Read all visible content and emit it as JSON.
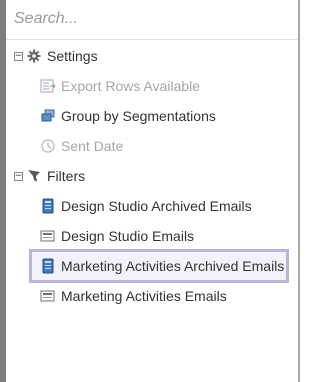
{
  "search": {
    "placeholder": "Search..."
  },
  "tree": {
    "settings": {
      "label": "Settings",
      "toggle": "−",
      "items": [
        {
          "label": "Export Rows Available",
          "icon": "export-rows-icon",
          "enabled": false
        },
        {
          "label": "Group by Segmentations",
          "icon": "segmentation-icon",
          "enabled": true
        },
        {
          "label": "Sent Date",
          "icon": "clock-icon",
          "enabled": false
        }
      ]
    },
    "filters": {
      "label": "Filters",
      "toggle": "−",
      "items": [
        {
          "label": "Design Studio Archived Emails",
          "icon": "archived-email-icon",
          "selected": false
        },
        {
          "label": "Design Studio Emails",
          "icon": "email-icon",
          "selected": false
        },
        {
          "label": "Marketing Activities Archived Emails",
          "icon": "archived-email-icon",
          "selected": true
        },
        {
          "label": "Marketing Activities Emails",
          "icon": "email-icon",
          "selected": false
        }
      ]
    }
  },
  "colors": {
    "selection_border": "#b9b4d9",
    "disabled_text": "#a6a6a6"
  }
}
